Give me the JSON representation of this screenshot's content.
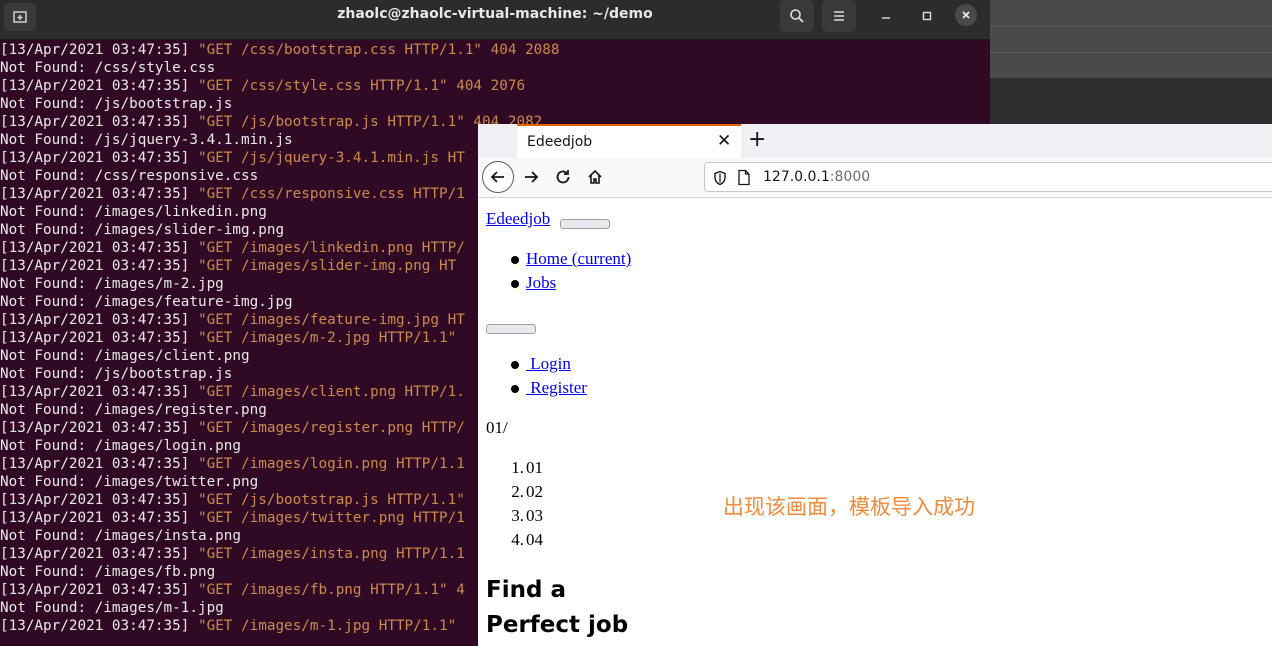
{
  "terminal": {
    "title": "zhaolc@zhaolc-virtual-machine: ~/demo",
    "lines": [
      {
        "ts": "[13/Apr/2021 03:47:35]",
        "req": " \"GET /css/bootstrap.css HTTP/1.1\" 404 2088"
      },
      {
        "text": "Not Found: /css/style.css"
      },
      {
        "ts": "[13/Apr/2021 03:47:35]",
        "req": " \"GET /css/style.css HTTP/1.1\" 404 2076"
      },
      {
        "text": "Not Found: /js/bootstrap.js"
      },
      {
        "ts": "[13/Apr/2021 03:47:35]",
        "req": " \"GET /js/bootstrap.js HTTP/1.1\" 404 2082"
      },
      {
        "text": "Not Found: /js/jquery-3.4.1.min.js"
      },
      {
        "ts": "[13/Apr/2021 03:47:35]",
        "req": " \"GET /js/jquery-3.4.1.min.js HT"
      },
      {
        "text": "Not Found: /css/responsive.css"
      },
      {
        "ts": "[13/Apr/2021 03:47:35]",
        "req": " \"GET /css/responsive.css HTTP/1"
      },
      {
        "text": "Not Found: /images/linkedin.png"
      },
      {
        "text": "Not Found: /images/slider-img.png"
      },
      {
        "ts": "[13/Apr/2021 03:47:35]",
        "req": " \"GET /images/linkedin.png HTTP/"
      },
      {
        "ts": "[13/Apr/2021 03:47:35]",
        "req": " \"GET /images/slider-img.png HT"
      },
      {
        "text": "Not Found: /images/m-2.jpg"
      },
      {
        "text": "Not Found: /images/feature-img.jpg"
      },
      {
        "ts": "[13/Apr/2021 03:47:35]",
        "req": " \"GET /images/feature-img.jpg HT"
      },
      {
        "ts": "[13/Apr/2021 03:47:35]",
        "req": " \"GET /images/m-2.jpg HTTP/1.1\""
      },
      {
        "text": "Not Found: /images/client.png"
      },
      {
        "text": "Not Found: /js/bootstrap.js"
      },
      {
        "ts": "[13/Apr/2021 03:47:35]",
        "req": " \"GET /images/client.png HTTP/1."
      },
      {
        "text": "Not Found: /images/register.png"
      },
      {
        "ts": "[13/Apr/2021 03:47:35]",
        "req": " \"GET /images/register.png HTTP/"
      },
      {
        "text": "Not Found: /images/login.png"
      },
      {
        "ts": "[13/Apr/2021 03:47:35]",
        "req": " \"GET /images/login.png HTTP/1.1"
      },
      {
        "text": "Not Found: /images/twitter.png"
      },
      {
        "ts": "[13/Apr/2021 03:47:35]",
        "req": " \"GET /js/bootstrap.js HTTP/1.1\""
      },
      {
        "ts": "[13/Apr/2021 03:47:35]",
        "req": " \"GET /images/twitter.png HTTP/1"
      },
      {
        "text": "Not Found: /images/insta.png"
      },
      {
        "ts": "[13/Apr/2021 03:47:35]",
        "req": " \"GET /images/insta.png HTTP/1.1"
      },
      {
        "text": "Not Found: /images/fb.png"
      },
      {
        "ts": "[13/Apr/2021 03:47:35]",
        "req": " \"GET /images/fb.png HTTP/1.1\" 4"
      },
      {
        "text": "Not Found: /images/m-1.jpg"
      },
      {
        "ts": "[13/Apr/2021 03:47:35]",
        "req": " \"GET /images/m-1.jpg HTTP/1.1\""
      }
    ]
  },
  "browser": {
    "tab_title": "Edeedjob",
    "url_host": "127.0.0.1",
    "url_port": ":8000"
  },
  "page": {
    "brand": "Edeedjob",
    "nav": [
      "Home (current)",
      "Jobs"
    ],
    "auth": [
      " Login",
      " Register"
    ],
    "slide_counter": "01/",
    "slides": [
      "01",
      "02",
      "03",
      "04"
    ],
    "heading_line1": "Find a",
    "heading_line2": "Perfect job"
  },
  "annotation": "出现该画面，模板导入成功",
  "colors": {
    "terminal_bg": "#300a24",
    "terminal_request": "#c98a4c",
    "annotation": "#f08a3c",
    "tab_accent": "#e66000",
    "link": "#0000ee"
  }
}
